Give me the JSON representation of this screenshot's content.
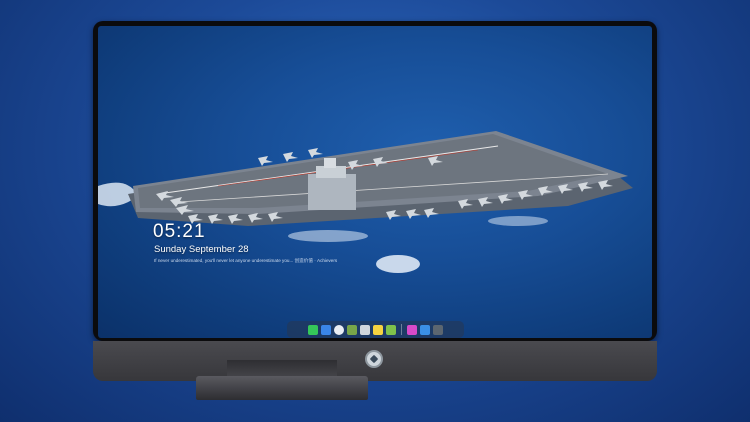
{
  "lockscreen": {
    "time": "05:21",
    "date": "Sunday September  28",
    "quote": "If never underestimated, you'll never let anyone underestimate you... 创造价值 · Achievers"
  },
  "dock": {
    "icons": [
      {
        "name": "messages-icon",
        "color": "#35c759"
      },
      {
        "name": "finder-icon",
        "color": "#3a86e8"
      },
      {
        "name": "safari-icon",
        "color": "#e9eef4"
      },
      {
        "name": "preview-icon",
        "color": "#78a64a"
      },
      {
        "name": "claquette-icon",
        "color": "#cfd6dd"
      },
      {
        "name": "notes-icon",
        "color": "#f5d341"
      },
      {
        "name": "photos-icon",
        "color": "#7fc24b"
      },
      {
        "name": "itunes-icon",
        "color": "#d74ac9"
      },
      {
        "name": "app-store-icon",
        "color": "#3a8fe6"
      },
      {
        "name": "camera-icon",
        "color": "#5c6670"
      }
    ]
  },
  "colors": {
    "page_background": "#1c4a98",
    "ocean": "#174e97",
    "bezel": "#0b0b0d",
    "chin": "#3e3e42"
  }
}
